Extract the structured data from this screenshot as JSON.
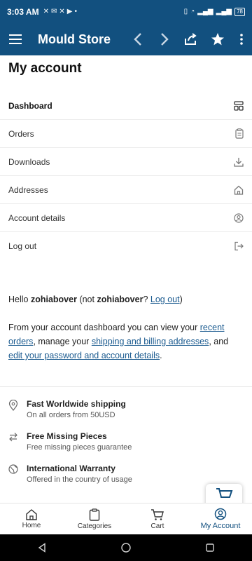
{
  "status_bar": {
    "time": "3:03 AM",
    "battery": "78"
  },
  "app_bar": {
    "title": "Mould Store"
  },
  "page": {
    "title": "My account"
  },
  "account_nav": [
    {
      "label": "Dashboard",
      "icon": "dashboard-icon"
    },
    {
      "label": "Orders",
      "icon": "clipboard-icon"
    },
    {
      "label": "Downloads",
      "icon": "download-icon"
    },
    {
      "label": "Addresses",
      "icon": "home-icon"
    },
    {
      "label": "Account details",
      "icon": "user-circle-icon"
    },
    {
      "label": "Log out",
      "icon": "logout-icon"
    }
  ],
  "welcome": {
    "hello": "Hello ",
    "username": "zohiabover",
    "not_prefix": " (not ",
    "not_username": "zohiabover",
    "question": "? ",
    "logout_link": "Log out",
    "close_paren": ")"
  },
  "dashboard_text": {
    "part1": "From your account dashboard you can view your ",
    "link_orders": "recent orders",
    "part2": ", manage your ",
    "link_addresses": "shipping and billing addresses",
    "part3": ", and ",
    "link_account": "edit your password and account details",
    "part4": "."
  },
  "features": [
    {
      "title": "Fast Worldwide shipping",
      "subtitle": "On all orders from 50USD",
      "icon": "map-pin-icon"
    },
    {
      "title": "Free Missing Pieces",
      "subtitle": "Free missing pieces guarantee",
      "icon": "swap-arrows-icon"
    },
    {
      "title": "International Warranty",
      "subtitle": "Offered in the country of usage",
      "icon": "globe-icon"
    }
  ],
  "tabs": [
    {
      "label": "Home",
      "icon": "home-icon"
    },
    {
      "label": "Categories",
      "icon": "clipboard-icon"
    },
    {
      "label": "Cart",
      "icon": "cart-icon"
    },
    {
      "label": "My Account",
      "icon": "account-icon"
    }
  ],
  "colors": {
    "brand": "#12507f",
    "link": "#1a5a8f"
  }
}
